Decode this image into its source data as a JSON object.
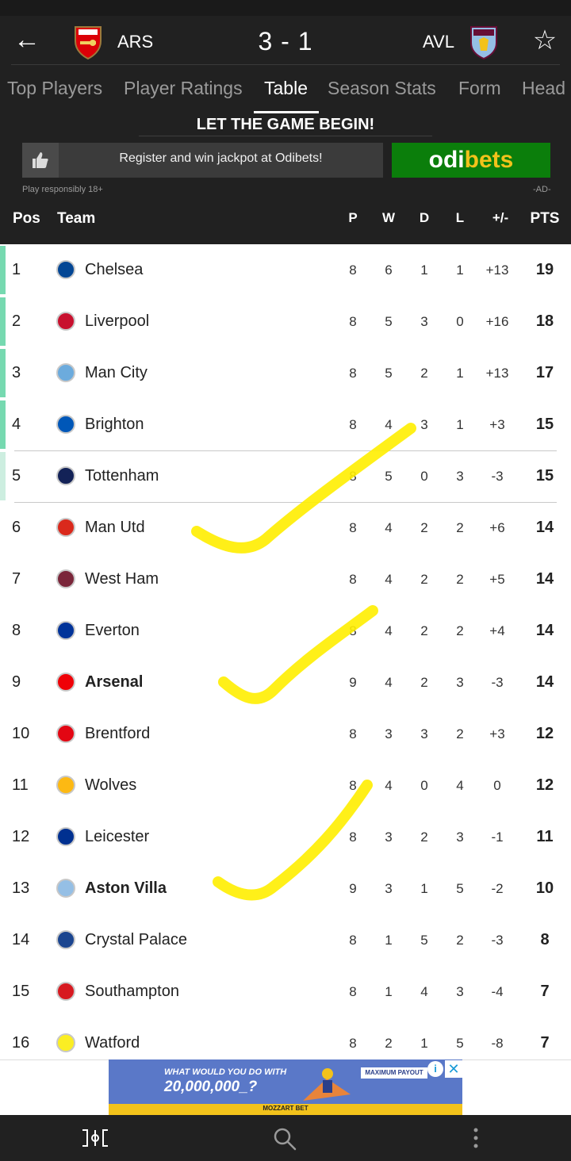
{
  "match": {
    "home": {
      "abbr": "ARS"
    },
    "away": {
      "abbr": "AVL"
    },
    "score": "3 - 1"
  },
  "icons": {
    "back": "arrow-left-icon",
    "favorite": "star-outline-icon",
    "ad_like": "thumbs-up-icon",
    "nav_lineup": "lineup-icon",
    "nav_search": "search-icon",
    "nav_more": "more-vertical-icon"
  },
  "tabs": [
    {
      "label": "Top Players"
    },
    {
      "label": "Player Ratings"
    },
    {
      "label": "Table",
      "active": true
    },
    {
      "label": "Season Stats"
    },
    {
      "label": "Form"
    },
    {
      "label": "Head"
    }
  ],
  "ad": {
    "headline": "LET THE GAME BEGIN!",
    "text": "Register and win jackpot at Odibets!",
    "brand_a": "odi",
    "brand_b": "bets",
    "responsible": "Play responsibly 18+",
    "ad_label": "-AD-"
  },
  "table": {
    "headers": {
      "pos": "Pos",
      "team": "Team",
      "p": "P",
      "w": "W",
      "d": "D",
      "l": "L",
      "gd": "+/-",
      "pts": "PTS"
    },
    "rows": [
      {
        "pos": "1",
        "team": "Chelsea",
        "p": "8",
        "w": "6",
        "d": "1",
        "l": "1",
        "gd": "+13",
        "pts": "19"
      },
      {
        "pos": "2",
        "team": "Liverpool",
        "p": "8",
        "w": "5",
        "d": "3",
        "l": "0",
        "gd": "+16",
        "pts": "18"
      },
      {
        "pos": "3",
        "team": "Man City",
        "p": "8",
        "w": "5",
        "d": "2",
        "l": "1",
        "gd": "+13",
        "pts": "17"
      },
      {
        "pos": "4",
        "team": "Brighton",
        "p": "8",
        "w": "4",
        "d": "3",
        "l": "1",
        "gd": "+3",
        "pts": "15"
      },
      {
        "pos": "5",
        "team": "Tottenham",
        "p": "8",
        "w": "5",
        "d": "0",
        "l": "3",
        "gd": "-3",
        "pts": "15"
      },
      {
        "pos": "6",
        "team": "Man Utd",
        "p": "8",
        "w": "4",
        "d": "2",
        "l": "2",
        "gd": "+6",
        "pts": "14"
      },
      {
        "pos": "7",
        "team": "West Ham",
        "p": "8",
        "w": "4",
        "d": "2",
        "l": "2",
        "gd": "+5",
        "pts": "14"
      },
      {
        "pos": "8",
        "team": "Everton",
        "p": "8",
        "w": "4",
        "d": "2",
        "l": "2",
        "gd": "+4",
        "pts": "14"
      },
      {
        "pos": "9",
        "team": "Arsenal",
        "p": "9",
        "w": "4",
        "d": "2",
        "l": "3",
        "gd": "-3",
        "pts": "14"
      },
      {
        "pos": "10",
        "team": "Brentford",
        "p": "8",
        "w": "3",
        "d": "3",
        "l": "2",
        "gd": "+3",
        "pts": "12"
      },
      {
        "pos": "11",
        "team": "Wolves",
        "p": "8",
        "w": "4",
        "d": "0",
        "l": "4",
        "gd": "0",
        "pts": "12"
      },
      {
        "pos": "12",
        "team": "Leicester",
        "p": "8",
        "w": "3",
        "d": "2",
        "l": "3",
        "gd": "-1",
        "pts": "11"
      },
      {
        "pos": "13",
        "team": "Aston Villa",
        "p": "9",
        "w": "3",
        "d": "1",
        "l": "5",
        "gd": "-2",
        "pts": "10"
      },
      {
        "pos": "14",
        "team": "Crystal Palace",
        "p": "8",
        "w": "1",
        "d": "5",
        "l": "2",
        "gd": "-3",
        "pts": "8"
      },
      {
        "pos": "15",
        "team": "Southampton",
        "p": "8",
        "w": "1",
        "d": "4",
        "l": "3",
        "gd": "-4",
        "pts": "7"
      },
      {
        "pos": "16",
        "team": "Watford",
        "p": "8",
        "w": "2",
        "d": "1",
        "l": "5",
        "gd": "-8",
        "pts": "7"
      }
    ]
  },
  "bottom_ad": {
    "question": "WHAT WOULD YOU DO WITH",
    "amount": "20,000,000_?",
    "pill": "MAXIMUM PAYOUT",
    "brand": "MOZZART BET"
  },
  "colors": {
    "dark": "#212121",
    "qualify": "#76d9b0",
    "qualify_light": "#cdeee0",
    "odibets_green": "#0b7e0b",
    "odibets_yellow": "#f2c21b",
    "tick_yellow": "#ffee00",
    "ad_blue": "#5a78c8"
  }
}
